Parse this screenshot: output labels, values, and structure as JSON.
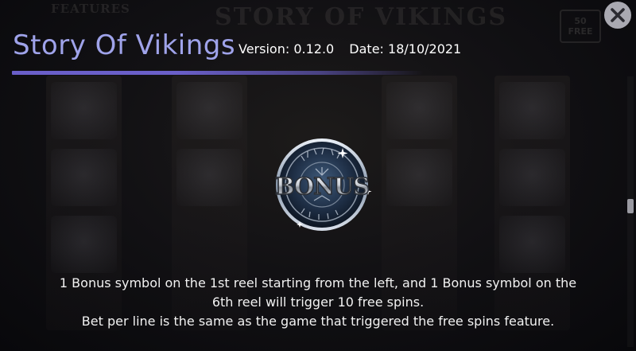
{
  "header": {
    "title": "Story Of Vikings",
    "version": "Version: 0.12.0",
    "date": "Date: 18/10/2021"
  },
  "symbol": {
    "label": "BONUS",
    "icon": "bonus-symbol-icon"
  },
  "description": {
    "line1": "1 Bonus symbol on the 1st reel starting from the left, and 1 Bonus symbol on the",
    "line2": "6th reel will trigger 10 free spins.",
    "line3": "Bet per line is the same as the game that triggered the free spins feature."
  },
  "colors": {
    "title": "#9fa3ea",
    "rule": "#6a5fc9",
    "close_bg": "#a9a9b1"
  }
}
